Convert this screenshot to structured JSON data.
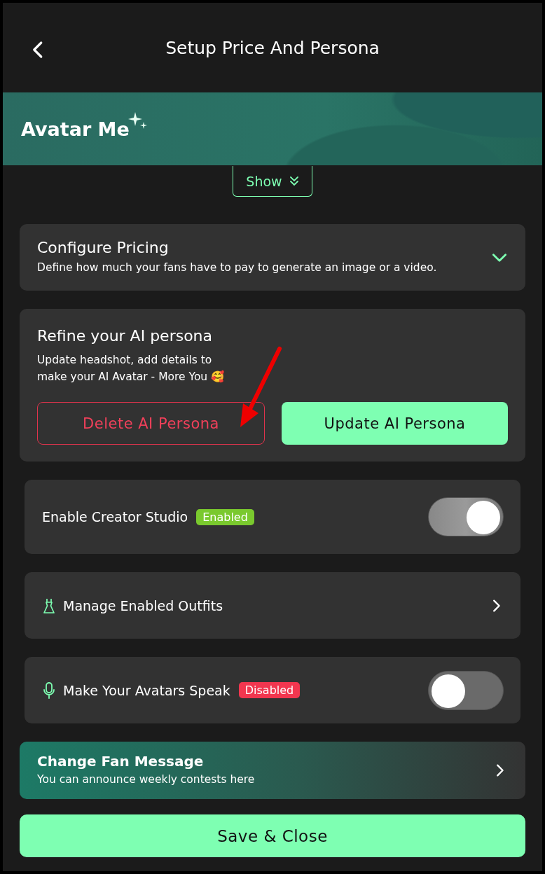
{
  "header": {
    "title": "Setup Price And Persona"
  },
  "banner": {
    "title": "Avatar Me"
  },
  "show_toggle": {
    "label": "Show",
    "expanded": false
  },
  "pricing": {
    "title": "Configure Pricing",
    "description": "Define how much your fans have to pay to generate an image or a video.",
    "expanded": false
  },
  "persona": {
    "title": "Refine your AI persona",
    "description": "Update headshot, add details to make your AI Avatar - More You 🥰",
    "buttons": [
      {
        "label": "Delete AI Persona",
        "kind": "danger"
      },
      {
        "label": "Update AI Persona",
        "kind": "primary"
      }
    ]
  },
  "settings": [
    {
      "kind": "toggle",
      "label": "Enable Creator Studio",
      "badge": {
        "label": "Enabled",
        "color": "#7ac92e"
      },
      "on": true
    },
    {
      "kind": "link",
      "label": "Manage Enabled Outfits"
    },
    {
      "kind": "toggle",
      "label": "Make Your Avatars Speak",
      "badge": {
        "label": "Disabled",
        "color": "#f2364f"
      },
      "on": false
    }
  ],
  "fan_message": {
    "title": "Change Fan Message",
    "description": "You can announce weekly contests here"
  },
  "footer": {
    "button": "Save & Close"
  }
}
